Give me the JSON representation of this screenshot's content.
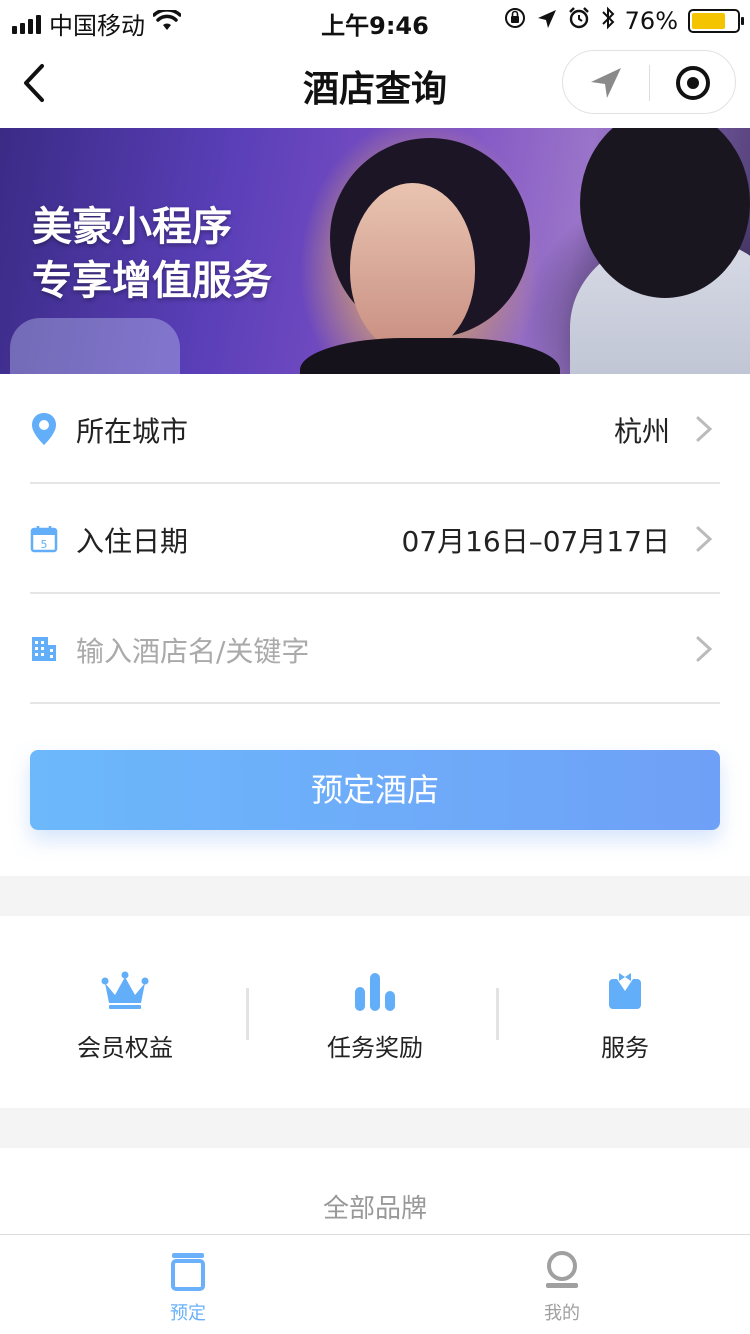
{
  "status_bar": {
    "carrier": "中国移动",
    "time": "上午9:46",
    "battery_percent": "76%",
    "battery_level": 0.76,
    "battery_color": "#f5c400"
  },
  "nav": {
    "title": "酒店查询",
    "back_icon": "chevron-left-icon",
    "capsule_icons": [
      "location-arrow-icon",
      "target-circle-icon"
    ]
  },
  "banner": {
    "line1": "美豪小程序",
    "line2": "专享增值服务"
  },
  "form": {
    "city": {
      "label": "所在城市",
      "value": "杭州",
      "icon": "location-pin-icon"
    },
    "date": {
      "label": "入住日期",
      "value": "07月16日–07月17日",
      "icon": "calendar-icon",
      "icon_day": "5"
    },
    "keyword": {
      "placeholder": "输入酒店名/关键字",
      "icon": "building-icon"
    }
  },
  "book_button": {
    "label": "预定酒店"
  },
  "features": [
    {
      "label": "会员权益",
      "icon": "crown-icon"
    },
    {
      "label": "任务奖励",
      "icon": "bar-chart-icon"
    },
    {
      "label": "服务",
      "icon": "butler-icon"
    }
  ],
  "brands": {
    "title": "全部品牌"
  },
  "tab_bar": {
    "tabs": [
      {
        "label": "预定",
        "icon": "booking-icon",
        "active": true
      },
      {
        "label": "我的",
        "icon": "profile-icon",
        "active": false
      }
    ]
  },
  "colors": {
    "accent": "#6ab0fa",
    "tab_active": "#6ab0fa",
    "tab_inactive": "#a0a0a0",
    "placeholder": "#aaaaaa",
    "divider": "#e5e5e5"
  }
}
